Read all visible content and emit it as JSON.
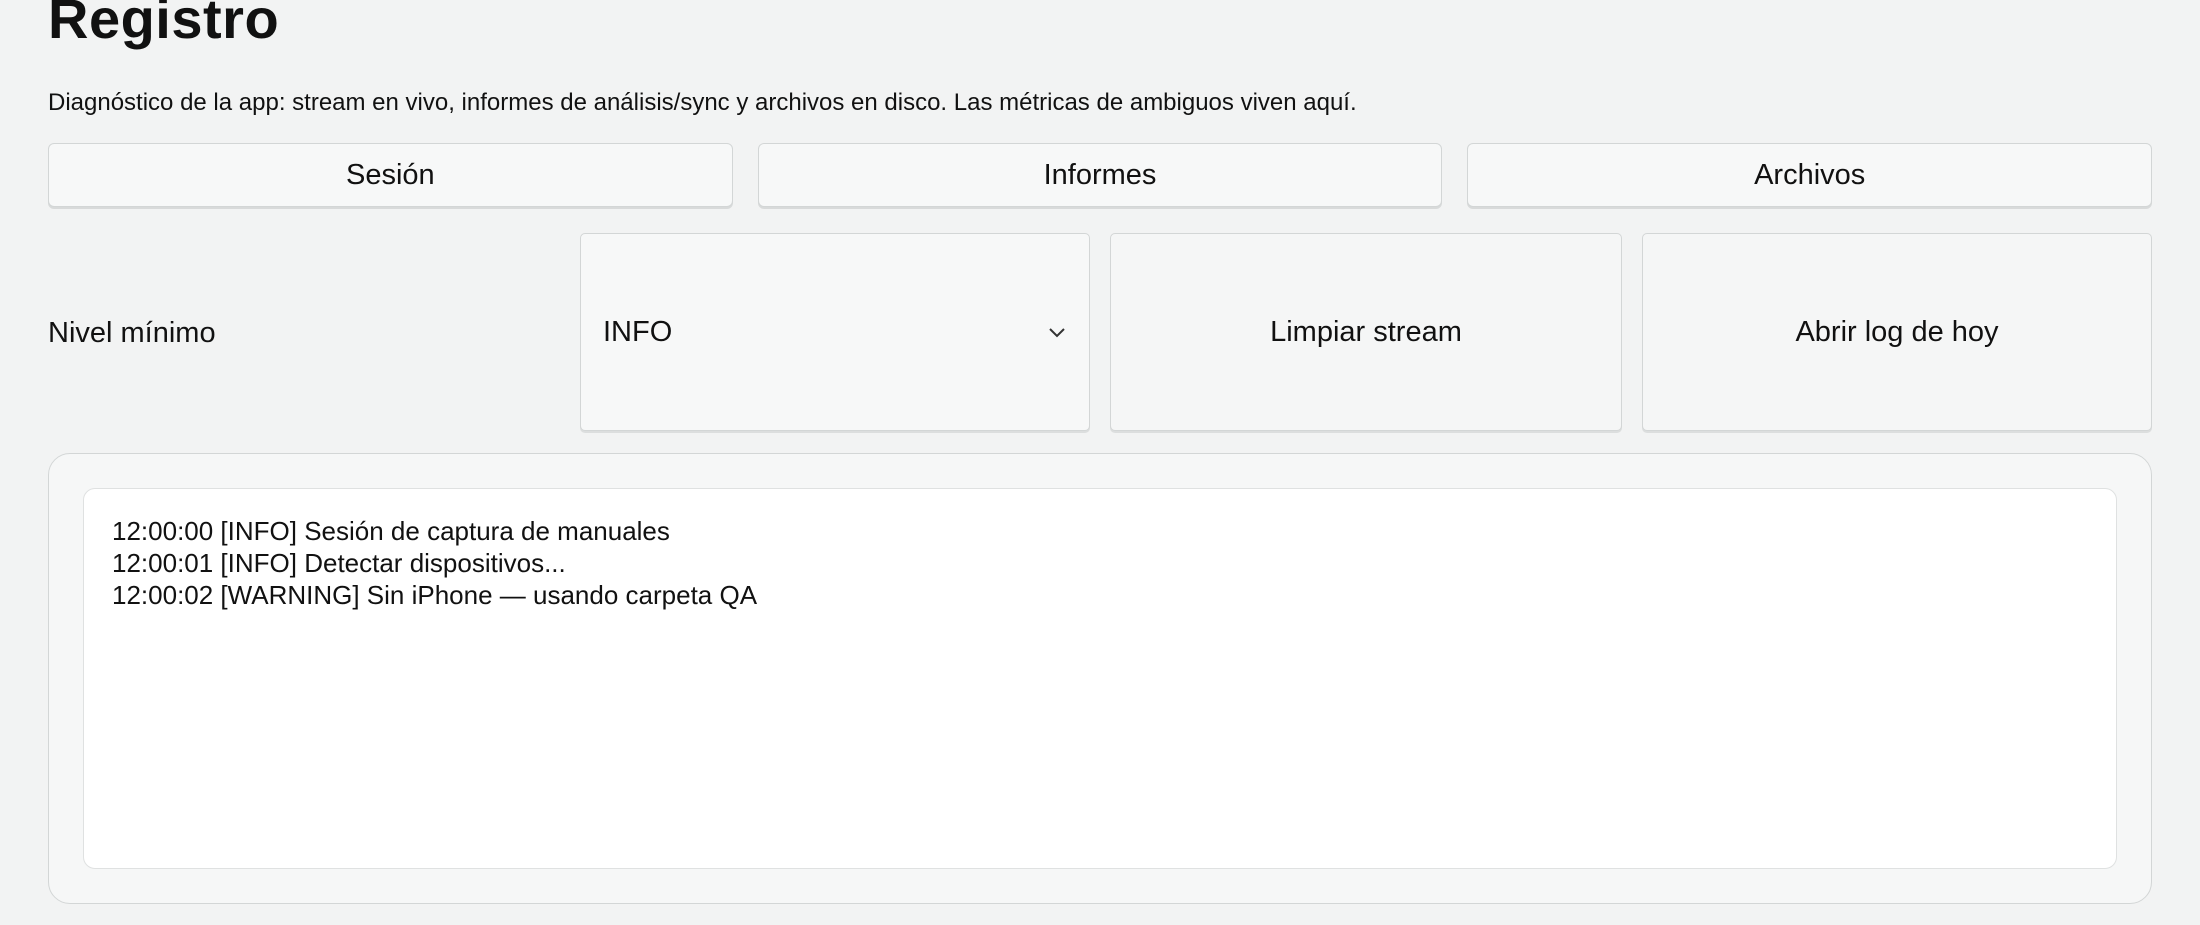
{
  "header": {
    "title": "Registro",
    "subtitle": "Diagnóstico de la app: stream en vivo, informes de análisis/sync y archivos en disco. Las métricas de ambiguos viven aquí."
  },
  "tabs": [
    {
      "label": "Sesión"
    },
    {
      "label": "Informes"
    },
    {
      "label": "Archivos"
    }
  ],
  "controls": {
    "level_label": "Nivel mínimo",
    "level_select": {
      "value": "INFO",
      "icon": "chevron-down-icon"
    },
    "clear_button": "Limpiar stream",
    "open_button": "Abrir log de hoy"
  },
  "log": {
    "lines": [
      "12:00:00 [INFO] Sesión de captura de manuales",
      "12:00:01 [INFO] Detectar dispositivos...",
      "12:00:02 [WARNING] Sin iPhone — usando carpeta QA"
    ]
  }
}
